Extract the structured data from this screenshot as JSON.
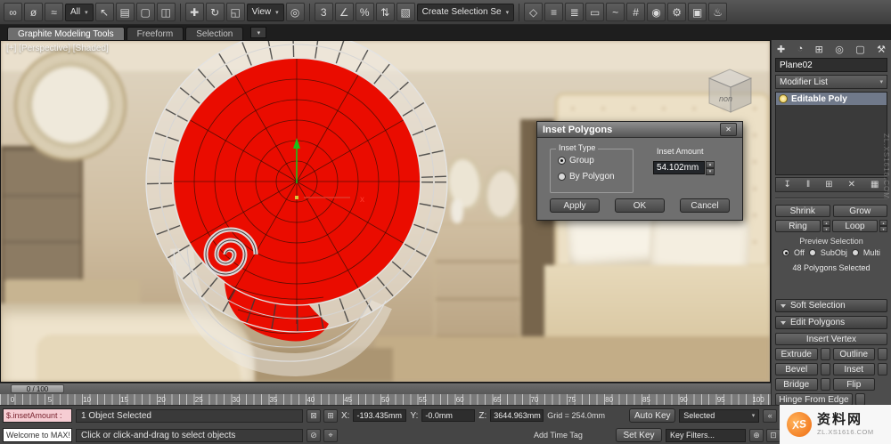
{
  "ui": {
    "chevron_down": "▾",
    "spinner_up": "▴",
    "spinner_down": "▾"
  },
  "toolbar": {
    "items": [
      {
        "type": "icon",
        "name": "select-and-link-icon",
        "glyph": "∞"
      },
      {
        "type": "icon",
        "name": "unlink-selection-icon",
        "glyph": "ø"
      },
      {
        "type": "icon",
        "name": "bind-to-spacewarp-icon",
        "glyph": "≈"
      },
      {
        "type": "dropdown",
        "name": "selection-filter-dropdown",
        "label": "All"
      },
      {
        "type": "icon",
        "name": "select-object-icon",
        "glyph": "↖"
      },
      {
        "type": "icon",
        "name": "select-by-name-icon",
        "glyph": "▤"
      },
      {
        "type": "icon",
        "name": "selection-region-icon",
        "glyph": "▢"
      },
      {
        "type": "icon",
        "name": "window-crossing-icon",
        "glyph": "◫"
      },
      {
        "type": "sep"
      },
      {
        "type": "icon",
        "name": "select-and-move-icon",
        "glyph": "✚"
      },
      {
        "type": "icon",
        "name": "select-and-rotate-icon",
        "glyph": "↻"
      },
      {
        "type": "icon",
        "name": "select-and-scale-icon",
        "glyph": "◱"
      },
      {
        "type": "dropdown",
        "name": "reference-coordinate-dropdown",
        "label": "View"
      },
      {
        "type": "icon",
        "name": "use-pivot-center-icon",
        "glyph": "◎"
      },
      {
        "type": "sep"
      },
      {
        "type": "icon",
        "name": "snaps-toggle-icon",
        "glyph": "3"
      },
      {
        "type": "icon",
        "name": "angle-snap-icon",
        "glyph": "∠"
      },
      {
        "type": "icon",
        "name": "percent-snap-icon",
        "glyph": "%"
      },
      {
        "type": "icon",
        "name": "spinner-snap-icon",
        "glyph": "⇅"
      },
      {
        "type": "icon",
        "name": "edit-named-sets-icon",
        "glyph": "▧"
      },
      {
        "type": "dropdown",
        "name": "named-selection-sets-dropdown",
        "label": "Create Selection Se"
      },
      {
        "type": "sep"
      },
      {
        "type": "icon",
        "name": "mirror-icon",
        "glyph": "◇"
      },
      {
        "type": "icon",
        "name": "align-icon",
        "glyph": "≡"
      },
      {
        "type": "icon",
        "name": "layer-manager-icon",
        "glyph": "≣"
      },
      {
        "type": "icon",
        "name": "ribbon-toggle-icon",
        "glyph": "▭"
      },
      {
        "type": "icon",
        "name": "curve-editor-icon",
        "glyph": "~"
      },
      {
        "type": "icon",
        "name": "schematic-view-icon",
        "glyph": "#"
      },
      {
        "type": "icon",
        "name": "material-editor-icon",
        "glyph": "◉"
      },
      {
        "type": "icon",
        "name": "render-setup-icon",
        "glyph": "⚙"
      },
      {
        "type": "icon",
        "name": "rendered-frame-icon",
        "glyph": "▣"
      },
      {
        "type": "icon",
        "name": "render-production-icon",
        "glyph": "♨"
      }
    ]
  },
  "ribbon": {
    "tabs": [
      "Graphite Modeling Tools",
      "Freeform",
      "Selection"
    ],
    "minimize_glyph": "▾"
  },
  "viewport": {
    "label": "[+] [Perspective] [Shaded]",
    "viewcube_label": "non",
    "gizmo_x_label": "x"
  },
  "dialog": {
    "title": "Inset Polygons",
    "close_glyph": "✕",
    "inset_type_label": "Inset Type",
    "options": [
      "Group",
      "By Polygon"
    ],
    "selected_option": "Group",
    "amount_label": "Inset Amount",
    "amount_value": "54.102mm",
    "apply": "Apply",
    "ok": "OK",
    "cancel": "Cancel"
  },
  "command_panel": {
    "tabs": [
      {
        "name": "create-tab-icon",
        "glyph": "✚"
      },
      {
        "name": "modify-tab-icon",
        "glyph": "◔"
      },
      {
        "name": "hierarchy-tab-icon",
        "glyph": "⊞"
      },
      {
        "name": "motion-tab-icon",
        "glyph": "◎"
      },
      {
        "name": "display-tab-icon",
        "glyph": "▢"
      },
      {
        "name": "utilities-tab-icon",
        "glyph": "⚒"
      }
    ],
    "object_name": "Plane02",
    "modifier_list_label": "Modifier List",
    "stack": [
      "Editable Poly"
    ],
    "stack_tools": [
      {
        "name": "pin-stack-icon",
        "glyph": "↧"
      },
      {
        "name": "show-end-result-icon",
        "glyph": "‖"
      },
      {
        "name": "make-unique-icon",
        "glyph": "⊞"
      },
      {
        "name": "remove-modifier-icon",
        "glyph": "✕"
      },
      {
        "name": "configure-modifier-sets-icon",
        "glyph": "▦"
      }
    ],
    "selection": {
      "shrink": "Shrink",
      "grow": "Grow",
      "ring": "Ring",
      "loop": "Loop",
      "preview_label": "Preview Selection",
      "preview_options": [
        "Off",
        "SubObj",
        "Multi"
      ],
      "selected_preview": "Off",
      "status": "48 Polygons Selected"
    },
    "rollouts": {
      "soft_selection": "Soft Selection",
      "edit_polygons": "Edit Polygons"
    },
    "edit": {
      "insert_vertex": "Insert Vertex",
      "buttons": [
        "Extrude",
        "Outline",
        "Bevel",
        "Inset",
        "Bridge",
        "Flip"
      ],
      "hinge_from_edge": "Hinge From Edge"
    }
  },
  "timeline": {
    "slider_label": "0 / 100",
    "ticks": [
      "0",
      "5",
      "10",
      "15",
      "20",
      "25",
      "30",
      "35",
      "40",
      "45",
      "50",
      "55",
      "60",
      "65",
      "70",
      "75",
      "80",
      "85",
      "90",
      "95",
      "100"
    ]
  },
  "status_bar": {
    "listener_top": "$.insetAmount :",
    "listener_bottom": "Welcome to MAX!",
    "selection_status": "1 Object Selected",
    "prompt": "Click or click-and-drag to select objects",
    "row1_icons": [
      {
        "name": "selection-lock-icon",
        "glyph": "⊠"
      },
      {
        "name": "absolute-mode-icon",
        "glyph": "⊞"
      }
    ],
    "row2_icons": [
      {
        "name": "isolate-selection-icon",
        "glyph": "⊘"
      },
      {
        "name": "offset-mode-icon",
        "glyph": "⌖"
      }
    ],
    "x_label": "X:",
    "x_value": "-193.435mm",
    "y_label": "Y:",
    "y_value": "-0.0mm",
    "z_label": "Z:",
    "z_value": "3644.963mm",
    "grid_label": "Grid = 254.0mm",
    "add_time_tag": "Add Time Tag",
    "auto_key": "Auto Key",
    "set_key": "Set Key",
    "selected_dropdown": "Selected",
    "key_filters": "Key Filters...",
    "transport_row1": [
      {
        "name": "go-to-start-icon",
        "glyph": "«"
      },
      {
        "name": "previous-frame-icon",
        "glyph": "‹"
      },
      {
        "name": "play-icon",
        "glyph": "►"
      },
      {
        "name": "next-frame-icon",
        "glyph": "›"
      },
      {
        "name": "go-to-end-icon",
        "glyph": "»"
      }
    ],
    "transport_row2": [
      {
        "name": "zoom-icon",
        "glyph": "⊕"
      },
      {
        "name": "zoom-extents-icon",
        "glyph": "⊡"
      },
      {
        "name": "pan-icon",
        "glyph": "⇔"
      },
      {
        "name": "orbit-icon",
        "glyph": "↻"
      },
      {
        "name": "maximize-viewport-icon",
        "glyph": "◱"
      }
    ]
  },
  "watermark": {
    "logo_text": "XS",
    "brand": "资料网",
    "url": "ZL.XS1616.COM"
  }
}
